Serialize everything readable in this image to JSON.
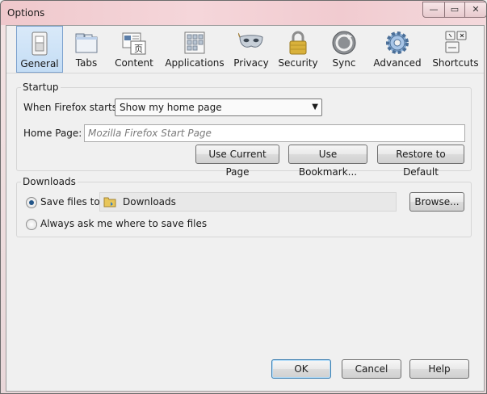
{
  "window": {
    "title": "Options",
    "minimize_glyph": "—",
    "maximize_glyph": "▭",
    "close_glyph": "✕"
  },
  "toolbar": {
    "tabs": [
      {
        "label": "General",
        "icon": "switch-icon",
        "selected": true
      },
      {
        "label": "Tabs",
        "icon": "tabs-icon"
      },
      {
        "label": "Content",
        "icon": "content-icon"
      },
      {
        "label": "Applications",
        "icon": "applications-icon"
      },
      {
        "label": "Privacy",
        "icon": "mask-icon"
      },
      {
        "label": "Security",
        "icon": "padlock-icon"
      },
      {
        "label": "Sync",
        "icon": "sync-icon"
      },
      {
        "label": "Advanced",
        "icon": "gear-icon"
      },
      {
        "label": "Shortcuts",
        "icon": "keyboard-icon"
      }
    ]
  },
  "startup": {
    "group_label": "Startup",
    "when_label": "When Firefox starts:",
    "when_value": "Show my home page",
    "home_label": "Home Page:",
    "home_placeholder": "Mozilla Firefox Start Page",
    "use_current_label": "Use Current Page",
    "use_bookmark_label": "Use Bookmark...",
    "restore_label": "Restore to Default"
  },
  "downloads": {
    "group_label": "Downloads",
    "save_files_label": "Save files to",
    "folder_name": "Downloads",
    "browse_label": "Browse...",
    "always_ask_label": "Always ask me where to save files"
  },
  "footer": {
    "ok_label": "OK",
    "cancel_label": "Cancel",
    "help_label": "Help"
  },
  "colors": {
    "selected_tab": "#c4ddf5",
    "accent_border": "#7da2ce",
    "titlebar": "#f1cbd0"
  }
}
